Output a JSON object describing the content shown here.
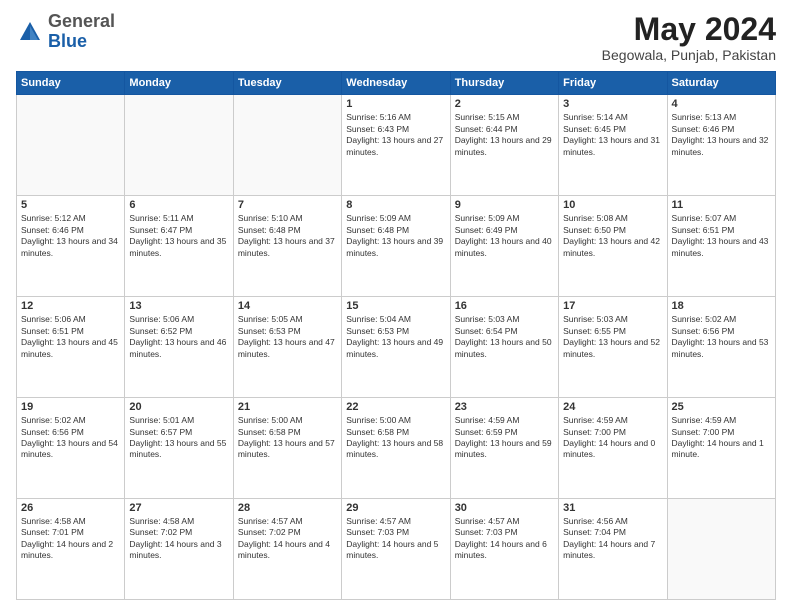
{
  "header": {
    "logo_general": "General",
    "logo_blue": "Blue",
    "month_year": "May 2024",
    "location": "Begowala, Punjab, Pakistan"
  },
  "weekdays": [
    "Sunday",
    "Monday",
    "Tuesday",
    "Wednesday",
    "Thursday",
    "Friday",
    "Saturday"
  ],
  "days": [
    {
      "num": "",
      "sunrise": "",
      "sunset": "",
      "daylight": ""
    },
    {
      "num": "",
      "sunrise": "",
      "sunset": "",
      "daylight": ""
    },
    {
      "num": "",
      "sunrise": "",
      "sunset": "",
      "daylight": ""
    },
    {
      "num": "1",
      "sunrise": "Sunrise: 5:16 AM",
      "sunset": "Sunset: 6:43 PM",
      "daylight": "Daylight: 13 hours and 27 minutes."
    },
    {
      "num": "2",
      "sunrise": "Sunrise: 5:15 AM",
      "sunset": "Sunset: 6:44 PM",
      "daylight": "Daylight: 13 hours and 29 minutes."
    },
    {
      "num": "3",
      "sunrise": "Sunrise: 5:14 AM",
      "sunset": "Sunset: 6:45 PM",
      "daylight": "Daylight: 13 hours and 31 minutes."
    },
    {
      "num": "4",
      "sunrise": "Sunrise: 5:13 AM",
      "sunset": "Sunset: 6:46 PM",
      "daylight": "Daylight: 13 hours and 32 minutes."
    },
    {
      "num": "5",
      "sunrise": "Sunrise: 5:12 AM",
      "sunset": "Sunset: 6:46 PM",
      "daylight": "Daylight: 13 hours and 34 minutes."
    },
    {
      "num": "6",
      "sunrise": "Sunrise: 5:11 AM",
      "sunset": "Sunset: 6:47 PM",
      "daylight": "Daylight: 13 hours and 35 minutes."
    },
    {
      "num": "7",
      "sunrise": "Sunrise: 5:10 AM",
      "sunset": "Sunset: 6:48 PM",
      "daylight": "Daylight: 13 hours and 37 minutes."
    },
    {
      "num": "8",
      "sunrise": "Sunrise: 5:09 AM",
      "sunset": "Sunset: 6:48 PM",
      "daylight": "Daylight: 13 hours and 39 minutes."
    },
    {
      "num": "9",
      "sunrise": "Sunrise: 5:09 AM",
      "sunset": "Sunset: 6:49 PM",
      "daylight": "Daylight: 13 hours and 40 minutes."
    },
    {
      "num": "10",
      "sunrise": "Sunrise: 5:08 AM",
      "sunset": "Sunset: 6:50 PM",
      "daylight": "Daylight: 13 hours and 42 minutes."
    },
    {
      "num": "11",
      "sunrise": "Sunrise: 5:07 AM",
      "sunset": "Sunset: 6:51 PM",
      "daylight": "Daylight: 13 hours and 43 minutes."
    },
    {
      "num": "12",
      "sunrise": "Sunrise: 5:06 AM",
      "sunset": "Sunset: 6:51 PM",
      "daylight": "Daylight: 13 hours and 45 minutes."
    },
    {
      "num": "13",
      "sunrise": "Sunrise: 5:06 AM",
      "sunset": "Sunset: 6:52 PM",
      "daylight": "Daylight: 13 hours and 46 minutes."
    },
    {
      "num": "14",
      "sunrise": "Sunrise: 5:05 AM",
      "sunset": "Sunset: 6:53 PM",
      "daylight": "Daylight: 13 hours and 47 minutes."
    },
    {
      "num": "15",
      "sunrise": "Sunrise: 5:04 AM",
      "sunset": "Sunset: 6:53 PM",
      "daylight": "Daylight: 13 hours and 49 minutes."
    },
    {
      "num": "16",
      "sunrise": "Sunrise: 5:03 AM",
      "sunset": "Sunset: 6:54 PM",
      "daylight": "Daylight: 13 hours and 50 minutes."
    },
    {
      "num": "17",
      "sunrise": "Sunrise: 5:03 AM",
      "sunset": "Sunset: 6:55 PM",
      "daylight": "Daylight: 13 hours and 52 minutes."
    },
    {
      "num": "18",
      "sunrise": "Sunrise: 5:02 AM",
      "sunset": "Sunset: 6:56 PM",
      "daylight": "Daylight: 13 hours and 53 minutes."
    },
    {
      "num": "19",
      "sunrise": "Sunrise: 5:02 AM",
      "sunset": "Sunset: 6:56 PM",
      "daylight": "Daylight: 13 hours and 54 minutes."
    },
    {
      "num": "20",
      "sunrise": "Sunrise: 5:01 AM",
      "sunset": "Sunset: 6:57 PM",
      "daylight": "Daylight: 13 hours and 55 minutes."
    },
    {
      "num": "21",
      "sunrise": "Sunrise: 5:00 AM",
      "sunset": "Sunset: 6:58 PM",
      "daylight": "Daylight: 13 hours and 57 minutes."
    },
    {
      "num": "22",
      "sunrise": "Sunrise: 5:00 AM",
      "sunset": "Sunset: 6:58 PM",
      "daylight": "Daylight: 13 hours and 58 minutes."
    },
    {
      "num": "23",
      "sunrise": "Sunrise: 4:59 AM",
      "sunset": "Sunset: 6:59 PM",
      "daylight": "Daylight: 13 hours and 59 minutes."
    },
    {
      "num": "24",
      "sunrise": "Sunrise: 4:59 AM",
      "sunset": "Sunset: 7:00 PM",
      "daylight": "Daylight: 14 hours and 0 minutes."
    },
    {
      "num": "25",
      "sunrise": "Sunrise: 4:59 AM",
      "sunset": "Sunset: 7:00 PM",
      "daylight": "Daylight: 14 hours and 1 minute."
    },
    {
      "num": "26",
      "sunrise": "Sunrise: 4:58 AM",
      "sunset": "Sunset: 7:01 PM",
      "daylight": "Daylight: 14 hours and 2 minutes."
    },
    {
      "num": "27",
      "sunrise": "Sunrise: 4:58 AM",
      "sunset": "Sunset: 7:02 PM",
      "daylight": "Daylight: 14 hours and 3 minutes."
    },
    {
      "num": "28",
      "sunrise": "Sunrise: 4:57 AM",
      "sunset": "Sunset: 7:02 PM",
      "daylight": "Daylight: 14 hours and 4 minutes."
    },
    {
      "num": "29",
      "sunrise": "Sunrise: 4:57 AM",
      "sunset": "Sunset: 7:03 PM",
      "daylight": "Daylight: 14 hours and 5 minutes."
    },
    {
      "num": "30",
      "sunrise": "Sunrise: 4:57 AM",
      "sunset": "Sunset: 7:03 PM",
      "daylight": "Daylight: 14 hours and 6 minutes."
    },
    {
      "num": "31",
      "sunrise": "Sunrise: 4:56 AM",
      "sunset": "Sunset: 7:04 PM",
      "daylight": "Daylight: 14 hours and 7 minutes."
    },
    {
      "num": "",
      "sunrise": "",
      "sunset": "",
      "daylight": ""
    }
  ]
}
